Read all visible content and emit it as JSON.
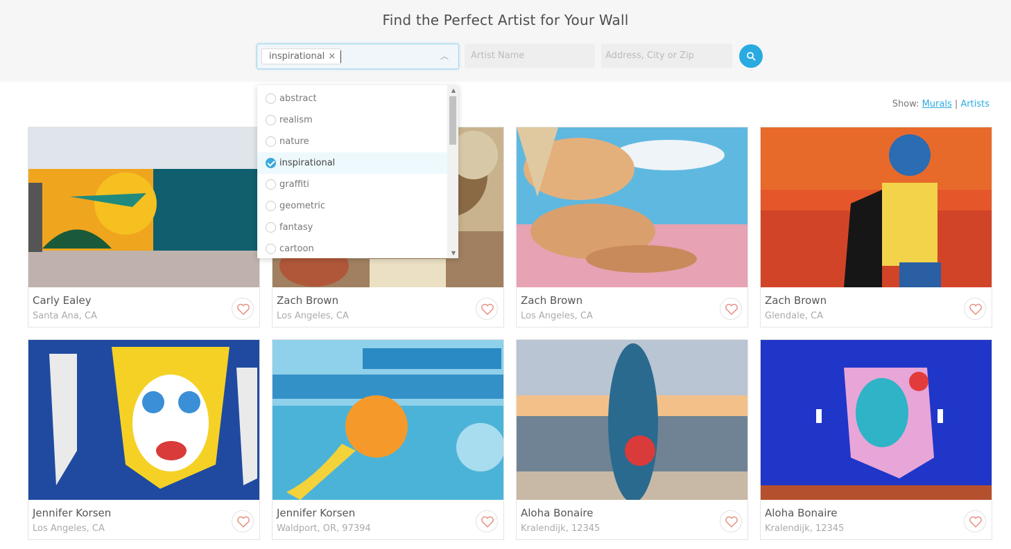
{
  "header": {
    "title": "Find the Perfect Artist for Your Wall"
  },
  "search": {
    "selected_tag": "inspirational",
    "artist_placeholder": "Artist Name",
    "address_placeholder": "Address, City or Zip"
  },
  "dropdown": {
    "options": [
      {
        "label": "abstract",
        "checked": false
      },
      {
        "label": "realism",
        "checked": false
      },
      {
        "label": "nature",
        "checked": false
      },
      {
        "label": "inspirational",
        "checked": true
      },
      {
        "label": "graffiti",
        "checked": false
      },
      {
        "label": "geometric",
        "checked": false
      },
      {
        "label": "fantasy",
        "checked": false
      },
      {
        "label": "cartoon",
        "checked": false
      }
    ]
  },
  "view_toggle": {
    "label": "Show:",
    "murals": "Murals",
    "separator": "|",
    "artists": "Artists",
    "active": "Murals"
  },
  "cards": [
    {
      "name": "Carly Ealey",
      "location": "Santa Ana, CA"
    },
    {
      "name": "Zach Brown",
      "location": "Los Angeles, CA"
    },
    {
      "name": "Zach Brown",
      "location": "Los Angeles, CA"
    },
    {
      "name": "Zach Brown",
      "location": "Glendale, CA"
    },
    {
      "name": "Jennifer Korsen",
      "location": "Los Angeles, CA"
    },
    {
      "name": "Jennifer Korsen",
      "location": "Waldport, OR, 97394"
    },
    {
      "name": "Aloha Bonaire",
      "location": "Kralendijk, 12345"
    },
    {
      "name": "Aloha Bonaire",
      "location": "Kralendijk, 12345"
    }
  ],
  "colors": {
    "accent": "#29abe2",
    "heart": "#e58a7a"
  }
}
